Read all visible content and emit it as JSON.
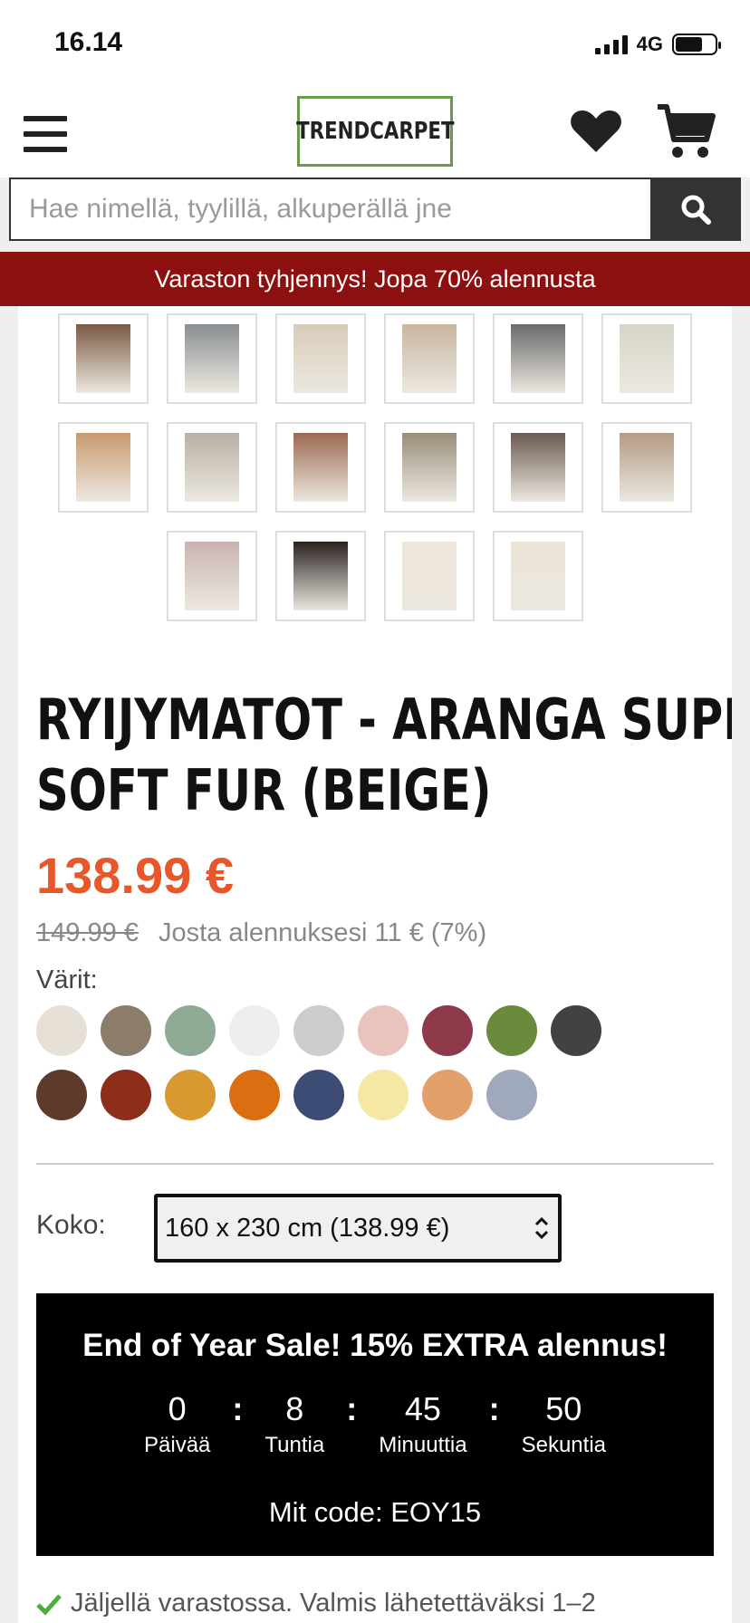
{
  "status_bar": {
    "time": "16.14",
    "network": "4G"
  },
  "header": {
    "logo_text": "TRENDCARPET",
    "menu_icon": "menu-icon",
    "wishlist_icon": "heart-icon",
    "cart_icon": "cart-icon"
  },
  "search": {
    "placeholder": "Hae nimellä, tyylillä, alkuperällä jne",
    "button_icon": "search-icon"
  },
  "banner": {
    "text": "Varaston tyhjennys! Jopa 70% alennusta"
  },
  "gallery": {
    "rows": [
      [
        "#7a5a44",
        "#8a8e92",
        "#d8ccb8",
        "#c8b6a0",
        "#6a6a6a",
        "#d6d4c8"
      ],
      [
        "#c89a70",
        "#b8b0a4",
        "#9c6a52",
        "#9a8e7a",
        "#6a5a52",
        "#b49a84"
      ],
      [
        "#c8b4b0",
        "#2a2220",
        "#efe6da",
        "#ece4d6"
      ]
    ]
  },
  "product": {
    "title_line1": "RYIJYMATOT - ARANGA SUPER",
    "title_line2": "SOFT FUR (BEIGE)",
    "price": "138.99 €",
    "old_price": "149.99 €",
    "discount_text": "Josta alennuksesi 11 € (7%)",
    "colors_label": "Värit:",
    "colors": [
      "#e6e0d6",
      "#8c7c6a",
      "#8eaa92",
      "#eeeeee",
      "#cccccc",
      "#e8c4bc",
      "#8e3a4a",
      "#6a8a3c",
      "#424242",
      "#5e3a2a",
      "#8c2e1a",
      "#d89a30",
      "#dc6e12",
      "#3c4c74",
      "#f4e8a4",
      "#e2a06a",
      "#a0a8bc"
    ],
    "size_label": "Koko:",
    "size_value": "160 x 230 cm (138.99 €)"
  },
  "sale": {
    "title": "End of Year Sale! 15% EXTRA alennus!",
    "countdown": [
      {
        "value": "0",
        "label": "Päivää"
      },
      {
        "value": "8",
        "label": "Tuntia"
      },
      {
        "value": "45",
        "label": "Minuuttia"
      },
      {
        "value": "50",
        "label": "Sekuntia"
      }
    ],
    "separator": ":",
    "code_text": "Mit code: EOY15"
  },
  "stock": {
    "text": "Jäljellä varastossa. Valmis lähetettäväksi 1–2",
    "icon": "check-icon",
    "icon_color": "#4caf3c"
  }
}
